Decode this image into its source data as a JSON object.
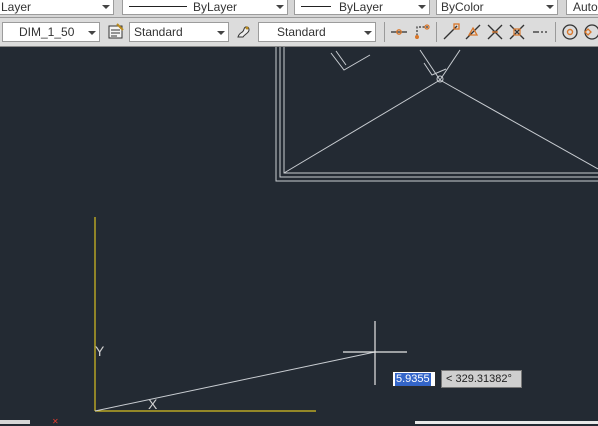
{
  "properties_bar": {
    "layer_value": "Layer",
    "linetype_value": "ByLayer",
    "lineweight_value": "ByLayer",
    "color_value": "ByColor",
    "plotstyle_value": "Auto"
  },
  "styles_bar": {
    "dimstyle_value": "DIM_1_50",
    "textstyle_value": "Standard",
    "tablestyle_value": "Standard"
  },
  "dynamic_input": {
    "distance_value": "5.9355",
    "angle_value": "< 329.31382°"
  },
  "ucs_icon": {
    "x_label": "X",
    "y_label": "Y"
  },
  "colors": {
    "canvas_bg": "#232a33",
    "ucs_axis": "#d8c021",
    "geometry": "#c9cdd2",
    "snap_icon": "#d9772b"
  }
}
